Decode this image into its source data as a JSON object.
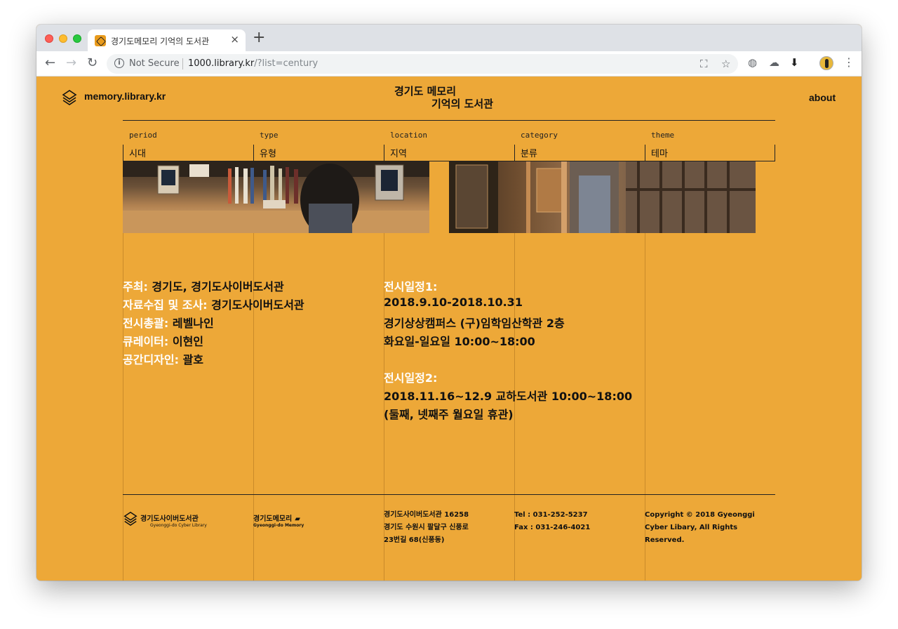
{
  "browser": {
    "tab_title": "경기도메모리 기억의 도서관",
    "tab_close": "×",
    "new_tab": "+",
    "not_secure": "Not Secure",
    "url_host": "1000.library.kr",
    "url_path": "/?list=century"
  },
  "header": {
    "site_name": "memory.library.kr",
    "title_line1": "경기도 메모리",
    "title_line2": "기억의 도서관",
    "about": "about"
  },
  "filters": [
    {
      "en": "period",
      "ko": "시대"
    },
    {
      "en": "type",
      "ko": "유형"
    },
    {
      "en": "location",
      "ko": "지역"
    },
    {
      "en": "category",
      "ko": "분류"
    },
    {
      "en": "theme",
      "ko": "테마"
    }
  ],
  "credits": [
    {
      "label": "주최:",
      "value": " 경기도, 경기도사이버도서관"
    },
    {
      "label": "자료수집 및 조사:",
      "value": " 경기도사이버도서관"
    },
    {
      "label": "전시총괄:",
      "value": " 레벨나인"
    },
    {
      "label": "큐레이터:",
      "value": " 이현인"
    },
    {
      "label": "공간디자인:",
      "value": " 괄호"
    }
  ],
  "schedule1": {
    "title": "전시일정1:",
    "lines": [
      "2018.9.10-2018.10.31",
      "경기상상캠퍼스 (구)임학임산학관 2층",
      "화요일-일요일 10:00~18:00"
    ]
  },
  "schedule2": {
    "title": "전시일정2:",
    "lines": [
      "2018.11.16~12.9 교하도서관 10:00~18:00",
      "(둘째, 넷째주 월요일 휴관)"
    ]
  },
  "footer": {
    "logo1_name": "경기도사이버도서관",
    "logo1_sub": "Gyeonggi-do Cyber Library",
    "logo2_name": "경기도메모리",
    "logo2_sub": "Gyeonggi-do Memory",
    "address": [
      "경기도사이버도서관 16258",
      "경기도 수원시 팔달구 신풍로",
      "23번길 68(신풍동)"
    ],
    "contact": [
      "Tel : 031-252-5237",
      "Fax : 031-246-4021"
    ],
    "copyright": [
      "Copyright © 2018 Gyeonggi",
      "Cyber Libary, All Rights",
      "Reserved."
    ]
  },
  "colors": {
    "page_bg": "#eda838",
    "label": "#ffffff",
    "text": "#111111"
  }
}
